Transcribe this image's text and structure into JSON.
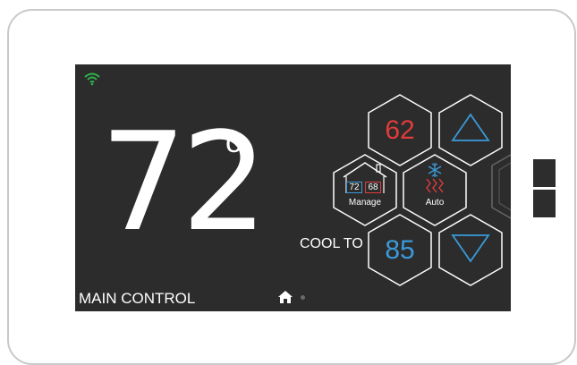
{
  "screen": {
    "current_temperature": "72",
    "degree_symbol": "o",
    "title": "MAIN CONTROL",
    "cool_label": "COOL TO",
    "heat_setpoint": "62",
    "cool_setpoint": "85",
    "manage": {
      "label": "Manage",
      "left_value": "72",
      "right_value": "68"
    },
    "mode": {
      "label": "Auto"
    }
  },
  "icons": [
    "wifi-icon",
    "house-icon",
    "snowflake-icon",
    "heat-waves-icon",
    "home-icon",
    "up-arrow-icon",
    "down-arrow-icon"
  ],
  "colors": {
    "screen_bg": "#2c2c2c",
    "heat": "#e23b3b",
    "cool": "#3a9ad9",
    "wifi": "#2fb34b",
    "text": "#ffffff"
  }
}
